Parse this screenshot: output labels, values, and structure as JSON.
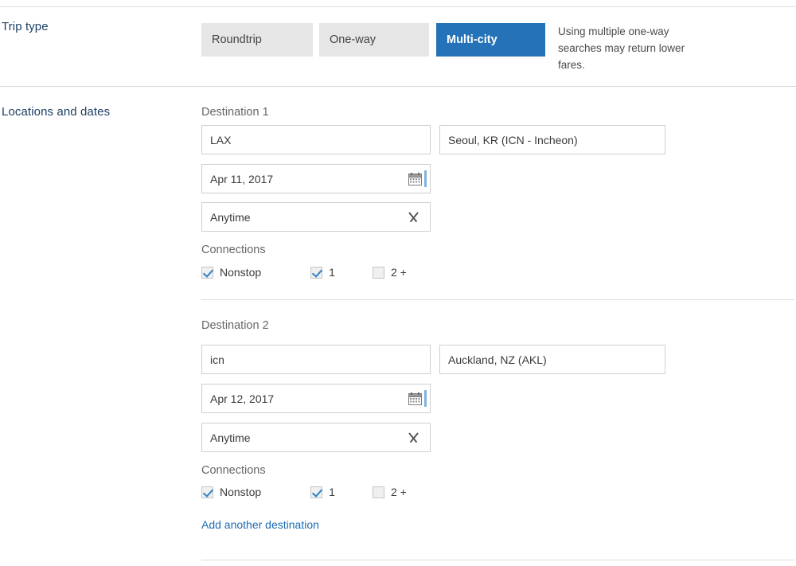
{
  "trip_type": {
    "label": "Trip type",
    "tabs": [
      {
        "label": "Roundtrip",
        "selected": false
      },
      {
        "label": "One-way",
        "selected": false
      },
      {
        "label": "Multi-city",
        "selected": true
      }
    ],
    "note": "Using multiple one-way searches may return lower fares."
  },
  "locations": {
    "label": "Locations and dates",
    "add_link": "Add another destination",
    "destinations": [
      {
        "title": "Destination 1",
        "origin": "LAX",
        "destination": "Seoul, KR (ICN - Incheon)",
        "date": "Apr 11, 2017",
        "time": "Anytime",
        "connections_label": "Connections",
        "connections": [
          {
            "label": "Nonstop",
            "checked": true
          },
          {
            "label": "1",
            "checked": true
          },
          {
            "label": "2 +",
            "checked": false
          }
        ]
      },
      {
        "title": "Destination 2",
        "origin": "icn",
        "destination": "Auckland, NZ (AKL)",
        "date": "Apr 12, 2017",
        "time": "Anytime",
        "connections_label": "Connections",
        "connections": [
          {
            "label": "Nonstop",
            "checked": true
          },
          {
            "label": "1",
            "checked": true
          },
          {
            "label": "2 +",
            "checked": false
          }
        ]
      }
    ]
  },
  "icons": {
    "calendar": "calendar-icon",
    "chevron": "chevron-down-icon"
  },
  "colors": {
    "accent_blue": "#2572b8",
    "link_blue": "#1b6bb5",
    "tab_gray": "#e6e6e6",
    "label_navy": "#1c3f63",
    "check_blue": "#2f7fc4"
  }
}
